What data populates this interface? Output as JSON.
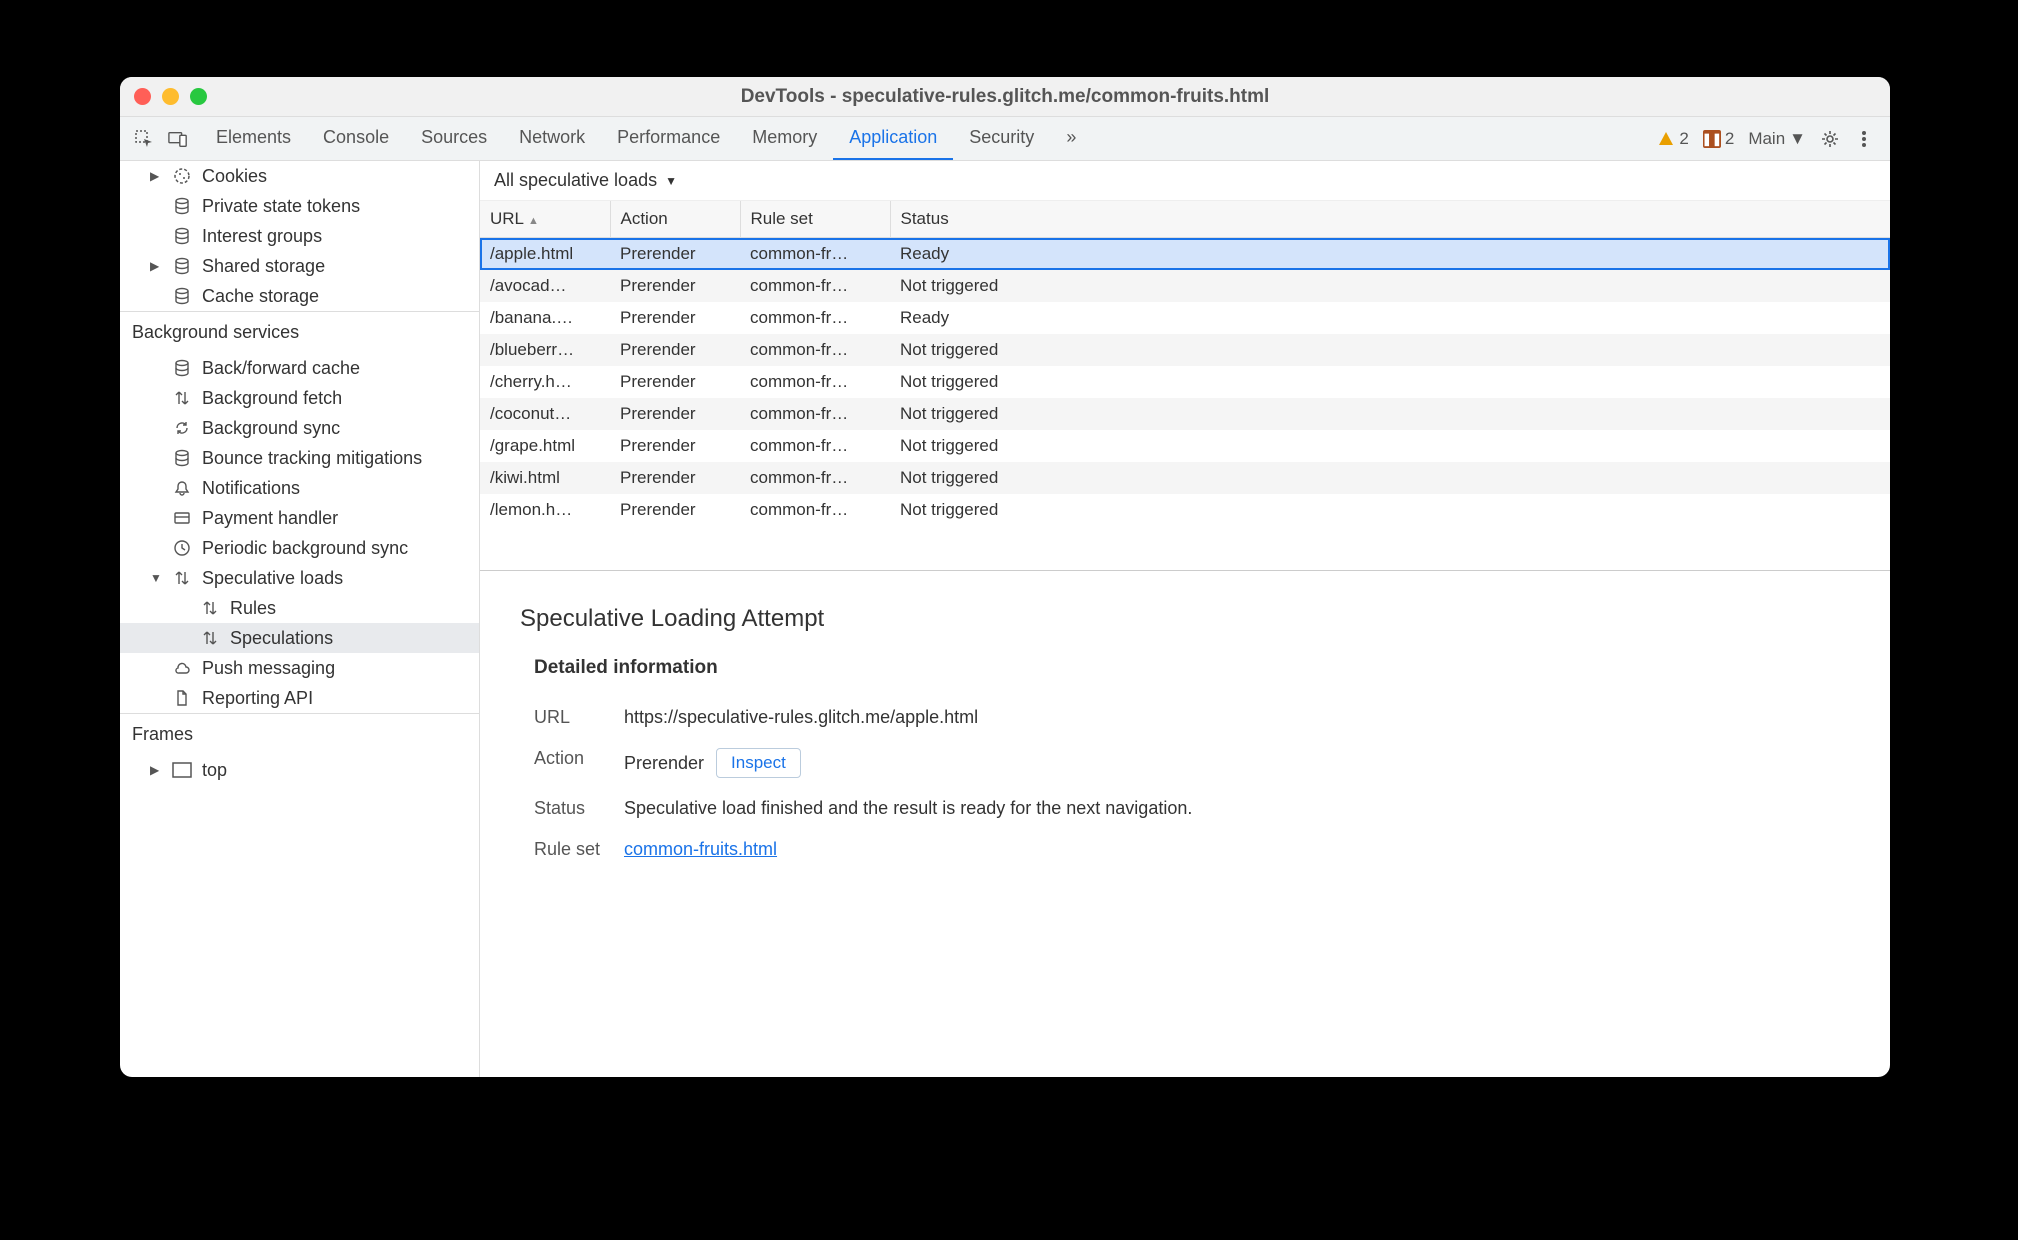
{
  "window": {
    "title": "DevTools - speculative-rules.glitch.me/common-fruits.html"
  },
  "toolbar": {
    "tabs": [
      "Elements",
      "Console",
      "Sources",
      "Network",
      "Performance",
      "Memory",
      "Application",
      "Security"
    ],
    "active_tab": "Application",
    "more_label": "»",
    "warnings_count": "2",
    "issues_count": "2",
    "context_label": "Main"
  },
  "sidebar": {
    "storage_items": [
      {
        "label": "Cookies",
        "icon": "cookie",
        "expandable": true
      },
      {
        "label": "Private state tokens",
        "icon": "db"
      },
      {
        "label": "Interest groups",
        "icon": "db"
      },
      {
        "label": "Shared storage",
        "icon": "db",
        "expandable": true
      },
      {
        "label": "Cache storage",
        "icon": "db"
      }
    ],
    "bg_title": "Background services",
    "bg_items": [
      {
        "label": "Back/forward cache",
        "icon": "db"
      },
      {
        "label": "Background fetch",
        "icon": "arrows"
      },
      {
        "label": "Background sync",
        "icon": "sync"
      },
      {
        "label": "Bounce tracking mitigations",
        "icon": "db"
      },
      {
        "label": "Notifications",
        "icon": "bell"
      },
      {
        "label": "Payment handler",
        "icon": "card"
      },
      {
        "label": "Periodic background sync",
        "icon": "clock"
      },
      {
        "label": "Speculative loads",
        "icon": "arrows",
        "expanded": true,
        "children": [
          {
            "label": "Rules",
            "icon": "arrows"
          },
          {
            "label": "Speculations",
            "icon": "arrows",
            "selected": true
          }
        ]
      },
      {
        "label": "Push messaging",
        "icon": "cloud"
      },
      {
        "label": "Reporting API",
        "icon": "doc"
      }
    ],
    "frames_title": "Frames",
    "frames_items": [
      {
        "label": "top",
        "icon": "frame",
        "expandable": true
      }
    ]
  },
  "filter": {
    "label": "All speculative loads"
  },
  "table": {
    "headers": [
      "URL",
      "Action",
      "Rule set",
      "Status"
    ],
    "rows": [
      {
        "url": "/apple.html",
        "action": "Prerender",
        "ruleset": "common-fr…",
        "status": "Ready",
        "selected": true
      },
      {
        "url": "/avocad…",
        "action": "Prerender",
        "ruleset": "common-fr…",
        "status": "Not triggered"
      },
      {
        "url": "/banana.…",
        "action": "Prerender",
        "ruleset": "common-fr…",
        "status": "Ready"
      },
      {
        "url": "/blueberr…",
        "action": "Prerender",
        "ruleset": "common-fr…",
        "status": "Not triggered"
      },
      {
        "url": "/cherry.h…",
        "action": "Prerender",
        "ruleset": "common-fr…",
        "status": "Not triggered"
      },
      {
        "url": "/coconut…",
        "action": "Prerender",
        "ruleset": "common-fr…",
        "status": "Not triggered"
      },
      {
        "url": "/grape.html",
        "action": "Prerender",
        "ruleset": "common-fr…",
        "status": "Not triggered"
      },
      {
        "url": "/kiwi.html",
        "action": "Prerender",
        "ruleset": "common-fr…",
        "status": "Not triggered"
      },
      {
        "url": "/lemon.h…",
        "action": "Prerender",
        "ruleset": "common-fr…",
        "status": "Not triggered"
      }
    ]
  },
  "details": {
    "heading": "Speculative Loading Attempt",
    "subheading": "Detailed information",
    "url_label": "URL",
    "url_value": "https://speculative-rules.glitch.me/apple.html",
    "action_label": "Action",
    "action_value": "Prerender",
    "inspect_button": "Inspect",
    "status_label": "Status",
    "status_value": "Speculative load finished and the result is ready for the next navigation.",
    "ruleset_label": "Rule set",
    "ruleset_value": "common-fruits.html"
  }
}
